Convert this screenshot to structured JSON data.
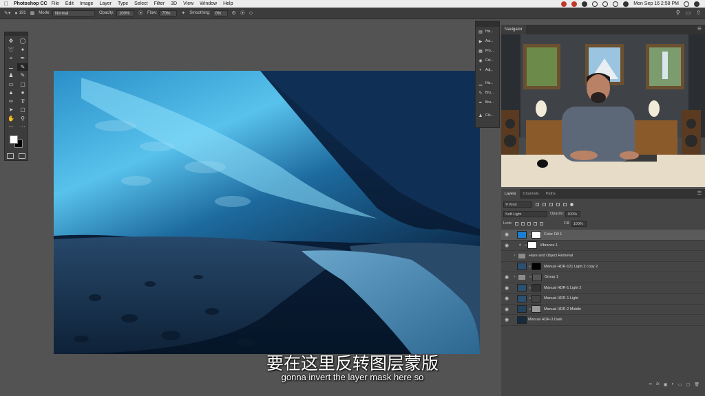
{
  "menubar": {
    "app_name": "Photoshop CC",
    "items": [
      "File",
      "Edit",
      "Image",
      "Layer",
      "Type",
      "Select",
      "Filter",
      "3D",
      "View",
      "Window",
      "Help"
    ],
    "datetime": "Mon Sep 16  2:58 PM"
  },
  "options": {
    "brush_size": "191",
    "mode_label": "Mode:",
    "mode_value": "Normal",
    "opacity_label": "Opacity:",
    "opacity_value": "100%",
    "flow_label": "Flow:",
    "flow_value": "70%",
    "smoothing_label": "Smoothing:",
    "smoothing_value": "0%"
  },
  "dock": {
    "items": [
      {
        "label": "His...",
        "icon": "history-icon"
      },
      {
        "label": "Act...",
        "icon": "actions-icon"
      },
      {
        "label": "Pro...",
        "icon": "properties-icon"
      },
      {
        "label": "Col...",
        "icon": "color-icon"
      },
      {
        "label": "Adj...",
        "icon": "adjustments-icon"
      },
      {
        "label": "His...",
        "icon": "histogram-icon"
      },
      {
        "label": "Bru...",
        "icon": "brush-settings-icon"
      },
      {
        "label": "Bru...",
        "icon": "brushes-icon"
      },
      {
        "label": "Clo...",
        "icon": "clone-source-icon"
      }
    ]
  },
  "navigator": {
    "tab": "Navigator"
  },
  "layers_panel": {
    "tabs": [
      "Layers",
      "Channels",
      "Paths"
    ],
    "kind_label": "Kind",
    "blend_mode": "Soft Light",
    "opacity_label": "Opacity:",
    "opacity_value": "100%",
    "lock_label": "Lock:",
    "fill_label": "Fill:",
    "fill_value": "100%",
    "layers": [
      {
        "name": "Color Fill 1",
        "type": "fill",
        "selected": true
      },
      {
        "name": "Vibrance 1",
        "type": "adjustment",
        "selected": false
      },
      {
        "name": "Haze and Object Removal",
        "type": "group",
        "selected": false
      },
      {
        "name": "Manual HDR-121 Light 2 copy 2",
        "type": "image-mask",
        "selected": false
      },
      {
        "name": "Group 1",
        "type": "group-mask",
        "selected": false
      },
      {
        "name": "Manual HDR-1 Light 2",
        "type": "image-mask",
        "selected": false
      },
      {
        "name": "Manual HDR-1 Light",
        "type": "image-mask",
        "selected": false
      },
      {
        "name": "Manual HDR-2 Middle",
        "type": "image-mask",
        "selected": false
      },
      {
        "name": "Manual HDR-3 Dark",
        "type": "image",
        "selected": false
      }
    ]
  },
  "subtitles": {
    "chinese": "要在这里反转图层蒙版",
    "english": "gonna invert the layer mask here so"
  },
  "colors": {
    "fill_swatch": "#1a7fd0",
    "foreground": "#ffffff",
    "background": "#000000"
  }
}
